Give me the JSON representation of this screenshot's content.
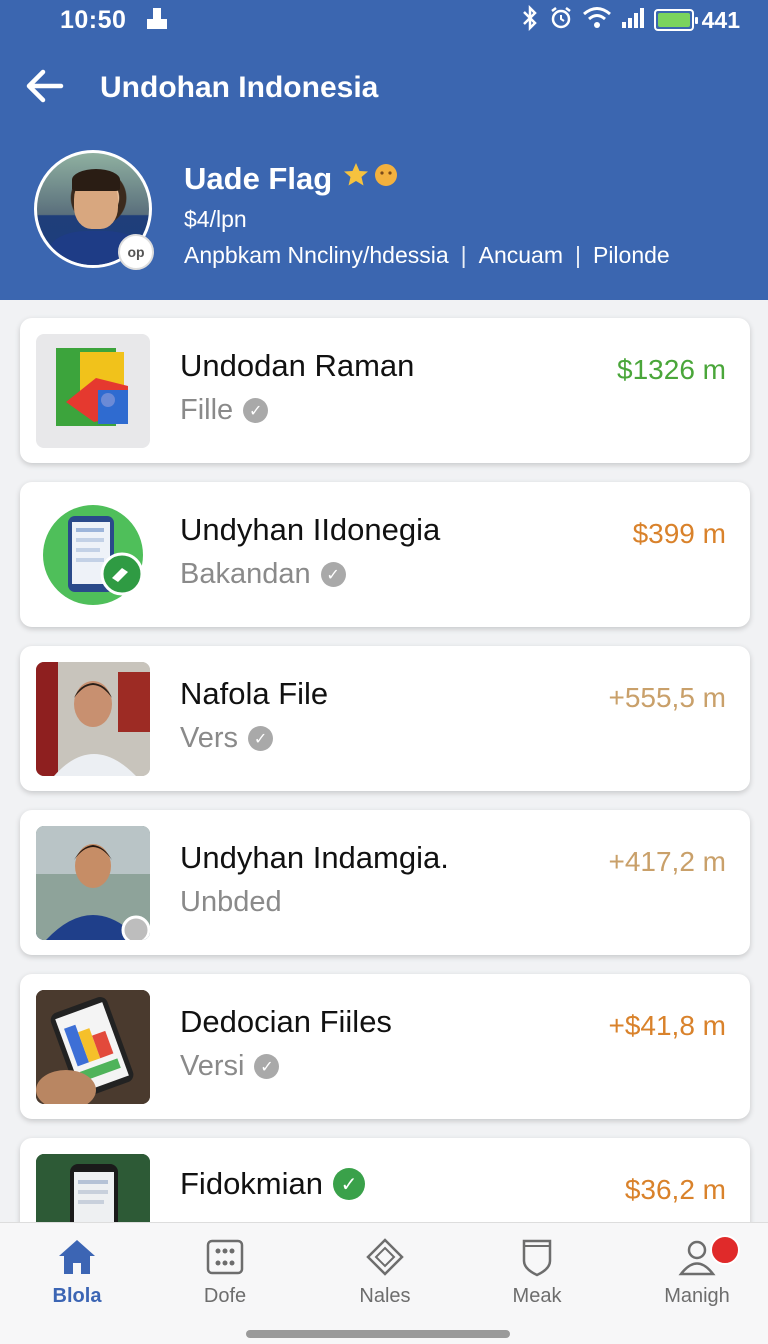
{
  "status": {
    "time": "10:50",
    "right_text": "441"
  },
  "appbar": {
    "title": "Undohan Indonesia"
  },
  "profile": {
    "name": "Uade Flag",
    "badge": "op",
    "price": "$4/lpn",
    "meta": [
      "Anpbkam Nncliny/hdessia",
      "Ancuam",
      "Pilonde"
    ]
  },
  "items": [
    {
      "title": "Undodan Raman",
      "subtitle": "Fille",
      "price": "$1326 m",
      "price_color": "#4aa63a",
      "verified": true
    },
    {
      "title": "Undyhan IIdonegia",
      "subtitle": "Bakandan",
      "price": "$399 m",
      "price_color": "#d9822b",
      "verified": true
    },
    {
      "title": "Nafola File",
      "subtitle": "Vers",
      "price": "+555,5 m",
      "price_color": "#c9a06a",
      "verified": true
    },
    {
      "title": "Undyhan Indamgia.",
      "subtitle": "Unbded",
      "price": "+417,2 m",
      "price_color": "#c9a06a",
      "verified": false
    },
    {
      "title": "Dedocian Fiiles",
      "subtitle": "Versi",
      "price": "+$41,8 m",
      "price_color": "#d9822b",
      "verified": true
    },
    {
      "title": "Fidokmian",
      "subtitle": "",
      "price": "$36,2 m",
      "price_color": "#d9822b",
      "verified": true
    }
  ],
  "nav": [
    {
      "label": "Blola",
      "icon": "home-icon",
      "active": true
    },
    {
      "label": "Dofe",
      "icon": "grid-icon",
      "active": false
    },
    {
      "label": "Nales",
      "icon": "diamond-icon",
      "active": false
    },
    {
      "label": "Meak",
      "icon": "shield-icon",
      "active": false
    },
    {
      "label": "Manigh",
      "icon": "profile-icon",
      "active": false
    }
  ],
  "colors": {
    "header": "#3b66b0",
    "nav_active": "#3c65b4"
  }
}
